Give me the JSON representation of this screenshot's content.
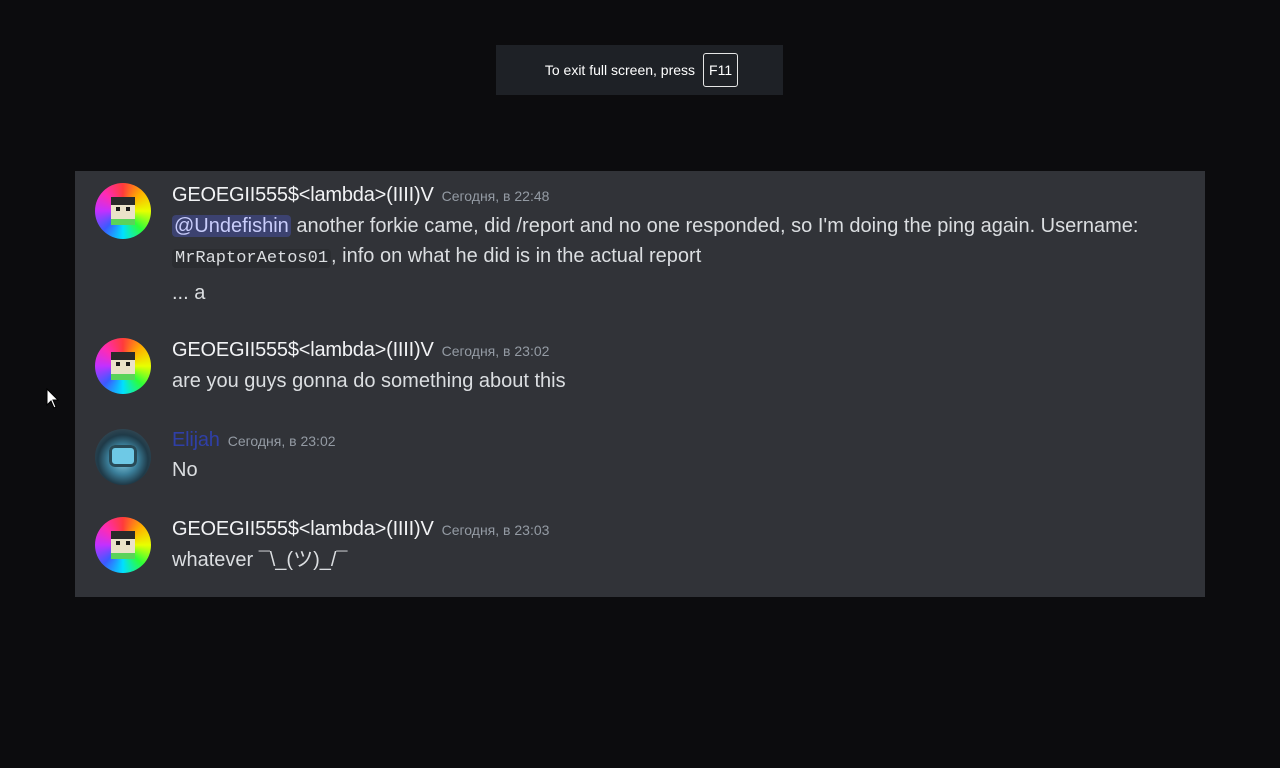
{
  "fullscreen_banner": {
    "text": "To exit full screen, press",
    "key": "F11"
  },
  "messages": [
    {
      "username": "GEOEGII555$<lambda>(IIII)V",
      "timestamp": "Сегодня, в 22:48",
      "avatar": "minecraft-rainbow-avatar",
      "mention": "@Undefishin",
      "line1_rest": " another forkie came, did /report and no one responded, so I'm doing the ping again. Username:",
      "code": "MrRaptorAetos01",
      "line2_rest": ", info on what he did is in the actual report",
      "line3": "... a"
    },
    {
      "username": "GEOEGII555$<lambda>(IIII)V",
      "timestamp": "Сегодня, в 23:02",
      "avatar": "minecraft-rainbow-avatar",
      "text": "are you guys gonna do something about this"
    },
    {
      "username": "Elijah",
      "username_color": "#2f3fa7",
      "timestamp": "Сегодня, в 23:02",
      "avatar": "blue-robot-avatar",
      "text": "No"
    },
    {
      "username": "GEOEGII555$<lambda>(IIII)V",
      "timestamp": "Сегодня, в 23:03",
      "avatar": "minecraft-rainbow-avatar",
      "text": "whatever ¯\\_(ツ)_/¯"
    }
  ],
  "colors": {
    "background": "#0c0c0e",
    "panel": "#313338",
    "mention_bg": "#3c4270",
    "text": "#dbdee1",
    "timestamp": "#949ba4"
  }
}
